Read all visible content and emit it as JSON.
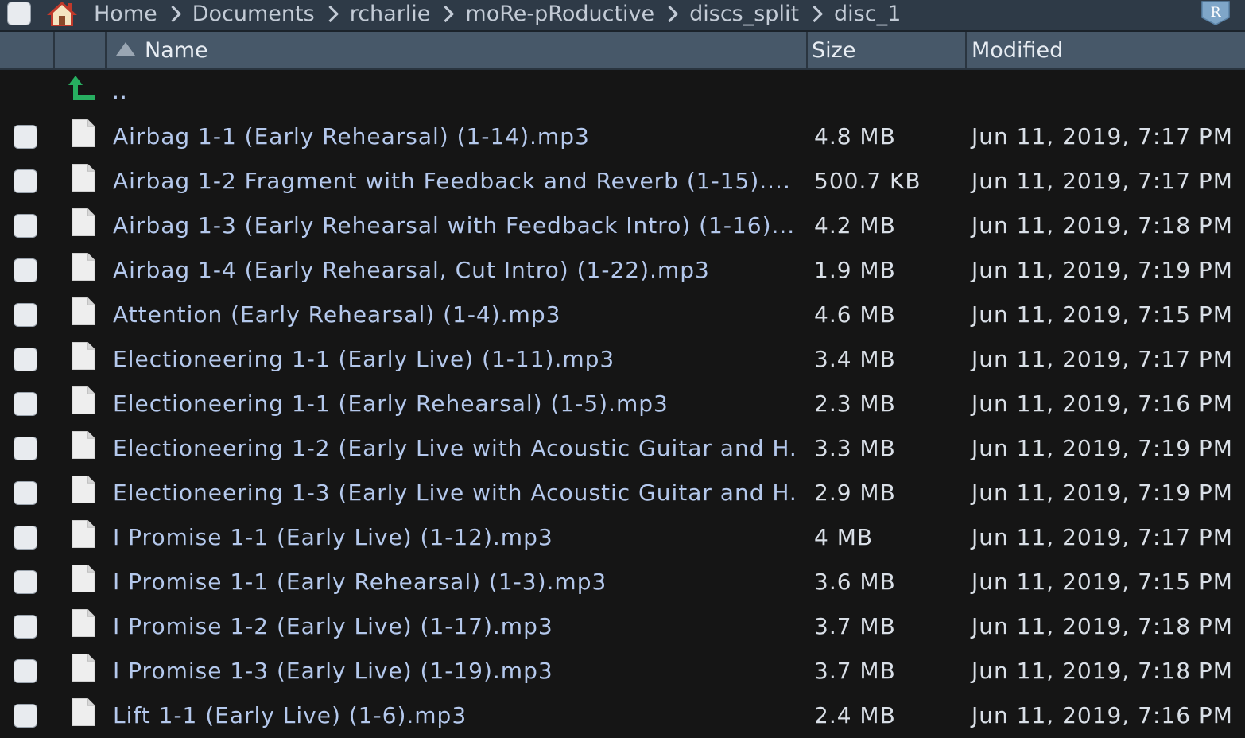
{
  "breadcrumb": [
    "Home",
    "Documents",
    "rcharlie",
    "moRe-pRoductive",
    "discs_split",
    "disc_1"
  ],
  "icons": {
    "home": "home-icon",
    "r_project": "r-project-icon",
    "parent": "up-arrow-icon",
    "file": "file-icon"
  },
  "columns": {
    "name": "Name",
    "size": "Size",
    "modified": "Modified",
    "sort": "ascending"
  },
  "parent_label": "..",
  "files": [
    {
      "name": "Airbag 1-1 (Early Rehearsal) (1-14).mp3",
      "size": "4.8 MB",
      "modified": "Jun 11, 2019, 7:17 PM"
    },
    {
      "name": "Airbag 1-2 Fragment with Feedback and Reverb (1-15)....",
      "size": "500.7 KB",
      "modified": "Jun 11, 2019, 7:17 PM"
    },
    {
      "name": "Airbag 1-3 (Early Rehearsal with Feedback Intro) (1-16)....",
      "size": "4.2 MB",
      "modified": "Jun 11, 2019, 7:18 PM"
    },
    {
      "name": "Airbag 1-4 (Early Rehearsal, Cut Intro) (1-22).mp3",
      "size": "1.9 MB",
      "modified": "Jun 11, 2019, 7:19 PM"
    },
    {
      "name": "Attention (Early Rehearsal) (1-4).mp3",
      "size": "4.6 MB",
      "modified": "Jun 11, 2019, 7:15 PM"
    },
    {
      "name": "Electioneering 1-1 (Early Live) (1-11).mp3",
      "size": "3.4 MB",
      "modified": "Jun 11, 2019, 7:17 PM"
    },
    {
      "name": "Electioneering 1-1 (Early Rehearsal) (1-5).mp3",
      "size": "2.3 MB",
      "modified": "Jun 11, 2019, 7:16 PM"
    },
    {
      "name": "Electioneering 1-2 (Early Live with Acoustic Guitar and H...",
      "size": "3.3 MB",
      "modified": "Jun 11, 2019, 7:19 PM"
    },
    {
      "name": "Electioneering 1-3 (Early Live with Acoustic Guitar and H...",
      "size": "2.9 MB",
      "modified": "Jun 11, 2019, 7:19 PM"
    },
    {
      "name": "I Promise 1-1 (Early Live) (1-12).mp3",
      "size": "4 MB",
      "modified": "Jun 11, 2019, 7:17 PM"
    },
    {
      "name": "I Promise 1-1 (Early Rehearsal) (1-3).mp3",
      "size": "3.6 MB",
      "modified": "Jun 11, 2019, 7:15 PM"
    },
    {
      "name": "I Promise 1-2 (Early Live) (1-17).mp3",
      "size": "3.7 MB",
      "modified": "Jun 11, 2019, 7:18 PM"
    },
    {
      "name": "I Promise 1-3 (Early Live) (1-19).mp3",
      "size": "3.7 MB",
      "modified": "Jun 11, 2019, 7:18 PM"
    },
    {
      "name": "Lift 1-1 (Early Live) (1-6).mp3",
      "size": "2.4 MB",
      "modified": "Jun 11, 2019, 7:16 PM"
    }
  ]
}
